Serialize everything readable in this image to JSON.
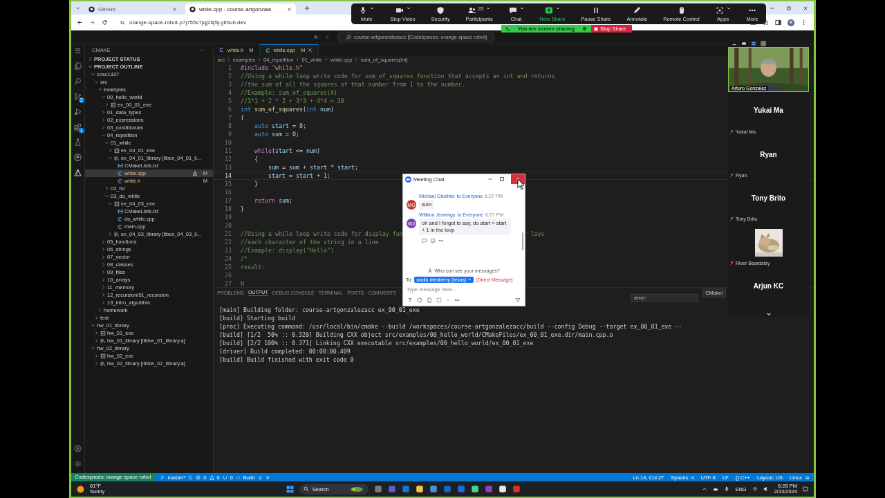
{
  "browser": {
    "tabs": [
      {
        "title": "GitHub",
        "selected": false
      },
      {
        "title": "while.cpp - course-artgonzale",
        "selected": true
      }
    ],
    "url": "orange-space-robot-p7j755v7jqj26j5j.github.dev"
  },
  "zoom_toolbar": {
    "items": [
      {
        "label": "Mute",
        "kind": "mic",
        "caret": true
      },
      {
        "label": "Stop Video",
        "kind": "video",
        "caret": true
      },
      {
        "label": "Security",
        "kind": "shield",
        "caret": false
      },
      {
        "label": "Participants",
        "kind": "people",
        "caret": true,
        "badge": "23"
      },
      {
        "label": "Chat",
        "kind": "chat",
        "caret": true
      },
      {
        "label": "New Share",
        "kind": "share",
        "caret": true
      },
      {
        "label": "Pause Share",
        "kind": "pause",
        "caret": false
      },
      {
        "label": "Annotate",
        "kind": "pencil",
        "caret": false
      },
      {
        "label": "Remote Control",
        "kind": "mouse",
        "caret": false
      },
      {
        "label": "Apps",
        "kind": "apps",
        "caret": true
      },
      {
        "label": "More",
        "kind": "more",
        "caret": false
      }
    ],
    "sharing_banner": "You are screen sharing",
    "stop_share": "Stop Share"
  },
  "title_bar": {
    "command_center": "course-artgonzalezacc [Codespaces: orange space robot]"
  },
  "activity_bar": [
    {
      "kind": "explorer"
    },
    {
      "kind": "search"
    },
    {
      "kind": "scm",
      "badge": "2"
    },
    {
      "kind": "run"
    },
    {
      "kind": "extensions",
      "badge": "1"
    },
    {
      "kind": "testing"
    },
    {
      "kind": "github"
    },
    {
      "kind": "cmake"
    }
  ],
  "sidebar": {
    "title": "CMAKE",
    "more": "···",
    "sections": [
      {
        "title": "PROJECT STATUS",
        "expanded": false
      },
      {
        "title": "PROJECT OUTLINE",
        "expanded": true,
        "children": [
          {
            "label": "cosc1337",
            "expanded": true,
            "selected": false,
            "children": [
              {
                "label": "src",
                "expanded": true,
                "selected": false,
                "children": [
                  {
                    "label": "examples",
                    "expanded": true,
                    "selected": false,
                    "children": [
                      {
                        "label": "00_hello_world",
                        "expanded": true,
                        "selected": false,
                        "children": [
                          {
                            "label": "ex_00_01_exe",
                            "kind": "exe",
                            "expanded": false,
                            "selected": false
                          }
                        ]
                      },
                      {
                        "label": "01_data_types",
                        "expanded": false,
                        "selected": false
                      },
                      {
                        "label": "02_expressions",
                        "expanded": false,
                        "selected": false
                      },
                      {
                        "label": "03_conditionals",
                        "expanded": false,
                        "selected": false
                      },
                      {
                        "label": "04_repetition",
                        "expanded": true,
                        "selected": false,
                        "children": [
                          {
                            "label": "01_while",
                            "expanded": true,
                            "selected": false,
                            "children": [
                              {
                                "label": "ex_04_01_exe",
                                "kind": "exe",
                                "expanded": false,
                                "selected": false
                              },
                              {
                                "label": "ex_04_01_library [libex_04_01_li...",
                                "kind": "library",
                                "expanded": true,
                                "selected": false,
                                "children": [
                                  {
                                    "label": "CMakeLists.txt",
                                    "kind": "cmake",
                                    "selected": false
                                  },
                                  {
                                    "label": "while.cpp",
                                    "kind": "cpp",
                                    "selected": true,
                                    "badge": "M"
                                  },
                                  {
                                    "label": "while.h",
                                    "kind": "h",
                                    "selected": false,
                                    "badge": "M"
                                  }
                                ]
                              }
                            ]
                          },
                          {
                            "label": "02_for",
                            "expanded": false,
                            "selected": false
                          },
                          {
                            "label": "03_do_while",
                            "expanded": true,
                            "selected": false,
                            "children": [
                              {
                                "label": "ex_04_03_exe",
                                "kind": "exe",
                                "expanded": true,
                                "selected": false,
                                "children": [
                                  {
                                    "label": "CMakeLists.txt",
                                    "kind": "cmake",
                                    "selected": false
                                  },
                                  {
                                    "label": "do_while.cpp",
                                    "kind": "cpp",
                                    "selected": false
                                  },
                                  {
                                    "label": "main.cpp",
                                    "kind": "cpp",
                                    "selected": false
                                  }
                                ]
                              },
                              {
                                "label": "ex_04_03_library [libex_04_03_li...",
                                "kind": "library",
                                "expanded": false,
                                "selected": false
                              }
                            ]
                          }
                        ]
                      },
                      {
                        "label": "05_functions",
                        "expanded": false,
                        "selected": false
                      },
                      {
                        "label": "06_strings",
                        "expanded": false,
                        "selected": false
                      },
                      {
                        "label": "07_vector",
                        "expanded": false,
                        "selected": false
                      },
                      {
                        "label": "08_classes",
                        "expanded": false,
                        "selected": false
                      },
                      {
                        "label": "09_files",
                        "expanded": false,
                        "selected": false
                      },
                      {
                        "label": "10_arrays",
                        "expanded": false,
                        "selected": false
                      },
                      {
                        "label": "11_memory",
                        "expanded": false,
                        "selected": false
                      },
                      {
                        "label": "12_recursion/01_recursion",
                        "expanded": false,
                        "selected": false
                      },
                      {
                        "label": "13_intro_algorithm",
                        "expanded": false,
                        "selected": false
                      }
                    ]
                  },
                  {
                    "label": "homework",
                    "expanded": false,
                    "selected": false
                  }
                ]
              },
              {
                "label": "test",
                "expanded": false,
                "selected": false
              }
            ]
          },
          {
            "label": "hw_01_library",
            "expanded": true,
            "selected": false,
            "children": [
              {
                "label": "hw_01_exe",
                "kind": "exe",
                "expanded": false,
                "selected": false
              },
              {
                "label": "hw_01_library [libhw_01_library.a]",
                "kind": "library",
                "expanded": false,
                "selected": false
              }
            ]
          },
          {
            "label": "hw_02_library",
            "expanded": true,
            "selected": false,
            "children": [
              {
                "label": "hw_02_exe",
                "kind": "exe",
                "expanded": false,
                "selected": false
              },
              {
                "label": "hw_02_library [libhw_02_library.a]",
                "kind": "library",
                "expanded": false,
                "selected": false
              }
            ]
          }
        ]
      }
    ]
  },
  "editor": {
    "tabs": [
      {
        "name": "while.h",
        "kind": "h",
        "badge": "M",
        "selected": false
      },
      {
        "name": "while.cpp",
        "kind": "cpp",
        "badge": "M",
        "selected": true
      }
    ],
    "breadcrumb": [
      "src",
      "examples",
      "04_repetition",
      "01_while",
      "while.cpp",
      "sum_of_squares(int)"
    ],
    "lines": [
      {
        "number": "1",
        "current": false,
        "segments": [
          {
            "text": "#include ",
            "kind": "directive"
          },
          {
            "text": "\"while.h\"",
            "kind": "string"
          }
        ]
      },
      {
        "number": "2",
        "current": false,
        "segments": [
          {
            "text": "//Using a while loop write code for sum_of_squares function that accepts an int and returns",
            "kind": "comment"
          }
        ]
      },
      {
        "number": "3",
        "current": false,
        "segments": [
          {
            "text": "//the sum of all the squares of that number from 1 to the number.",
            "kind": "comment"
          }
        ]
      },
      {
        "number": "4",
        "current": false,
        "segments": [
          {
            "text": "//Example: sum_of_squares(4)",
            "kind": "comment"
          }
        ]
      },
      {
        "number": "5",
        "current": false,
        "segments": [
          {
            "text": "//1*1 + 2 * 2 + 3*3 + 4*4 = 30",
            "kind": "comment"
          }
        ]
      },
      {
        "number": "6",
        "current": false,
        "segments": [
          {
            "text": "int",
            "kind": "keyword"
          },
          {
            "text": " sum_of_squares",
            "kind": "function"
          },
          {
            "text": "(",
            "kind": "plain"
          },
          {
            "text": "int",
            "kind": "keyword"
          },
          {
            "text": " num",
            "kind": "variable"
          },
          {
            "text": ")",
            "kind": "plain"
          }
        ]
      },
      {
        "number": "7",
        "current": false,
        "segments": [
          {
            "text": "{",
            "kind": "plain"
          }
        ]
      },
      {
        "number": "8",
        "current": false,
        "segments": [
          {
            "text": "    auto",
            "kind": "keyword"
          },
          {
            "text": " start",
            "kind": "variable"
          },
          {
            "text": " = ",
            "kind": "plain"
          },
          {
            "text": "0",
            "kind": "number"
          },
          {
            "text": ";",
            "kind": "plain"
          }
        ]
      },
      {
        "number": "9",
        "current": false,
        "segments": [
          {
            "text": "    auto",
            "kind": "keyword"
          },
          {
            "text": " sum",
            "kind": "variable"
          },
          {
            "text": " = ",
            "kind": "plain"
          },
          {
            "text": "0",
            "kind": "number"
          },
          {
            "text": ";",
            "kind": "plain"
          }
        ]
      },
      {
        "number": "10",
        "current": false
      },
      {
        "number": "11",
        "current": false,
        "segments": [
          {
            "text": "    while",
            "kind": "control"
          },
          {
            "text": "(",
            "kind": "plain"
          },
          {
            "text": "start",
            "kind": "variable"
          },
          {
            "text": " <= ",
            "kind": "plain"
          },
          {
            "text": "num",
            "kind": "variable"
          },
          {
            "text": ")",
            "kind": "plain"
          }
        ]
      },
      {
        "number": "12",
        "current": false,
        "segments": [
          {
            "text": "    {",
            "kind": "plain"
          }
        ]
      },
      {
        "number": "13",
        "current": false,
        "segments": [
          {
            "text": "        sum",
            "kind": "variable"
          },
          {
            "text": " = ",
            "kind": "plain"
          },
          {
            "text": "sum",
            "kind": "variable"
          },
          {
            "text": " + ",
            "kind": "plain"
          },
          {
            "text": "start",
            "kind": "variable"
          },
          {
            "text": " * ",
            "kind": "plain"
          },
          {
            "text": "start",
            "kind": "variable"
          },
          {
            "text": ";",
            "kind": "plain"
          }
        ]
      },
      {
        "number": "14",
        "current": true,
        "segments": [
          {
            "text": "        start",
            "kind": "variable"
          },
          {
            "text": " = ",
            "kind": "plain"
          },
          {
            "text": "start",
            "kind": "variable"
          },
          {
            "text": " + ",
            "kind": "plain"
          },
          {
            "text": "1",
            "kind": "number"
          },
          {
            "text": ";",
            "kind": "plain"
          }
        ]
      },
      {
        "number": "15",
        "current": false,
        "segments": [
          {
            "text": "    }",
            "kind": "plain"
          }
        ]
      },
      {
        "number": "16",
        "current": false
      },
      {
        "number": "17",
        "current": false,
        "segments": [
          {
            "text": "    return",
            "kind": "control"
          },
          {
            "text": " sum",
            "kind": "variable"
          },
          {
            "text": ";",
            "kind": "plain"
          }
        ]
      },
      {
        "number": "18",
        "current": false,
        "segments": [
          {
            "text": "}",
            "kind": "plain"
          }
        ]
      },
      {
        "number": "19",
        "current": false
      },
      {
        "number": "20",
        "current": false
      },
      {
        "number": "21",
        "current": false,
        "segments": [
          {
            "text": "//Using a while loop write code for display fun",
            "kind": "comment"
          },
          {
            "text": "lays",
            "kind": "comment-tail"
          }
        ]
      },
      {
        "number": "22",
        "current": false,
        "segments": [
          {
            "text": "//each character of the string in a line",
            "kind": "comment"
          }
        ]
      },
      {
        "number": "23",
        "current": false,
        "segments": [
          {
            "text": "//Example: display(\"Hello\")",
            "kind": "comment"
          }
        ]
      },
      {
        "number": "24",
        "current": false,
        "segments": [
          {
            "text": "/*",
            "kind": "comment"
          }
        ]
      },
      {
        "number": "25",
        "current": false,
        "segments": [
          {
            "text": "result:",
            "kind": "comment"
          }
        ]
      },
      {
        "number": "26",
        "current": false
      },
      {
        "number": "27",
        "current": false,
        "segments": [
          {
            "text": "H",
            "kind": "comment"
          }
        ]
      }
    ]
  },
  "panel": {
    "tabs": [
      {
        "label": "PROBLEMS",
        "selected": false
      },
      {
        "label": "OUTPUT",
        "selected": true
      },
      {
        "label": "DEBUG CONSOLE",
        "selected": false
      },
      {
        "label": "TERMINAL",
        "selected": false
      },
      {
        "label": "PORTS",
        "selected": false
      },
      {
        "label": "COMMENTS",
        "selected": false
      }
    ],
    "channel": "CMake/",
    "filter": "error:",
    "output": [
      "[main] Building folder: course-artgonzalezacc ex_00_01_exe",
      "[build] Starting build",
      "[proc] Executing command: /usr/local/bin/cmake --build /workspaces/course-artgonzalezacc/build --config Debug --target ex_00_01_exe --",
      "[build] [1/2  50% :: 0.320] Building CXX object src/examples/00_hello_world/CMakeFiles/ex_00_01_exe.dir/main.cpp.o",
      "[build] [2/2 100% :: 0.371] Linking CXX executable src/examples/00_hello_world/ex_00_01_exe",
      "[driver] Build completed: 00:00:00.409",
      "[build] Build finished with exit code 0"
    ]
  },
  "meeting_chat": {
    "title": "Meeting Chat",
    "messages": [
      {
        "sender": "Michael Glushko",
        "audience": "to Everyone",
        "time": "6:27 PM",
        "initials": "MG",
        "color": "#c0392b",
        "text": "sum"
      },
      {
        "sender": "William Jennings",
        "audience": "to Everyone",
        "time": "6:27 PM",
        "initials": "WJ",
        "color": "#7b3fb5",
        "text": "oh and I forgot to say, do start = start + 1 in the loop"
      }
    ],
    "privacy_link": "Who can see your messages?",
    "to_label": "To:",
    "recipient": "nadia ritenberry (texas)",
    "direct": "(Direct Message)",
    "placeholder": "Type message here..."
  },
  "gallery": {
    "tiles": [
      {
        "kind": "video",
        "label": "Arturo Gonzalez"
      },
      {
        "kind": "name",
        "name": "Yukai Ma",
        "label": "Yukai Ma",
        "muted": true
      },
      {
        "kind": "name",
        "name": "Ryan",
        "label": "Ryan",
        "muted": true
      },
      {
        "kind": "name",
        "name": "Tony Brito",
        "label": "Tony Brito",
        "muted": true
      },
      {
        "kind": "picture",
        "label": "River Beardsley",
        "muted": true
      },
      {
        "kind": "name",
        "name": "Arjun KC"
      }
    ]
  },
  "status_bar": {
    "remote": "Codespaces: orange space robot",
    "branch": "master*",
    "errors": "0",
    "warnings": "0",
    "ports": "0",
    "build": "Build",
    "right": [
      "Ln 14, Col 27",
      "Spaces: 4",
      "UTF-8",
      "LF",
      "{} C++",
      "Layout: US",
      "Linux"
    ]
  },
  "taskbar": {
    "temperature": "61°F",
    "weather": "Sunny",
    "search": "Search",
    "language": "ENG",
    "time": "6:28 PM",
    "date": "2/13/2024"
  }
}
